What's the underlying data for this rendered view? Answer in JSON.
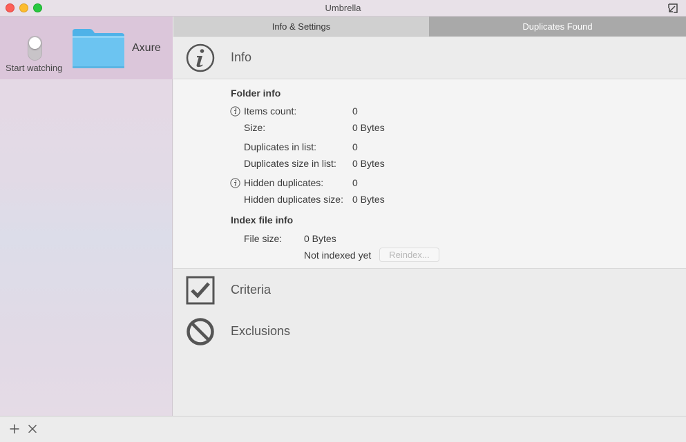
{
  "window": {
    "title": "Umbrella"
  },
  "sidebar": {
    "folder": {
      "name": "Axure",
      "watch_label": "Start watching",
      "watching": false
    }
  },
  "tabs": [
    {
      "label": "Info & Settings",
      "active": true
    },
    {
      "label": "Duplicates Found",
      "active": false
    }
  ],
  "info": {
    "title": "Info",
    "folder_info_heading": "Folder info",
    "rows": {
      "items_count": {
        "label": "Items count:",
        "value": "0"
      },
      "size": {
        "label": "Size:",
        "value": "0 Bytes"
      },
      "duplicates_in_list": {
        "label": "Duplicates in list:",
        "value": "0"
      },
      "duplicates_size": {
        "label": "Duplicates size in list:",
        "value": "0 Bytes"
      },
      "hidden_duplicates": {
        "label": "Hidden duplicates:",
        "value": "0"
      },
      "hidden_duplicates_size": {
        "label": "Hidden duplicates size:",
        "value": "0 Bytes"
      }
    },
    "index_heading": "Index file info",
    "file_size": {
      "label": "File size:",
      "value": "0 Bytes"
    },
    "index_status": "Not indexed yet",
    "reindex_label": "Reindex..."
  },
  "criteria": {
    "title": "Criteria"
  },
  "exclusions": {
    "title": "Exclusions"
  },
  "footer": {
    "add_icon": "plus-icon",
    "remove_icon": "close-icon"
  },
  "colors": {
    "sidebar_selected": "#dbc6da",
    "tab_inactive": "#a9a9a9",
    "tab_active": "#d0d0d0",
    "icon_gray": "#555555"
  }
}
